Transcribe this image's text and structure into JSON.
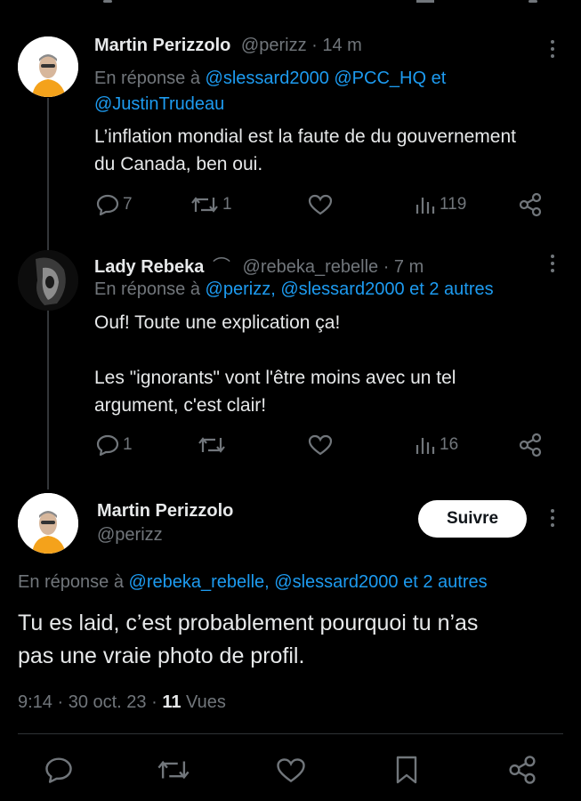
{
  "replies": [
    {
      "author": "Martin Perizzolo",
      "handle": "@perizz",
      "time": "· 14 m",
      "reply_to_prefix": "En réponse à",
      "reply_to_line1": "@slessard2000 @PCC_HQ et",
      "reply_to_line2": "@JustinTrudeau",
      "text_line1": "L’inflation mondial est la faute de du gouvernement",
      "text_line2": "du Canada, ben oui.",
      "stats": {
        "replies": "7",
        "reposts": "1",
        "views": "119"
      }
    },
    {
      "author": "Lady Rebeka",
      "author_emoji": "⌒",
      "handle": "@rebeka_rebelle",
      "time": "· 7 m",
      "reply_to_prefix": "En réponse à",
      "reply_to": "@perizz, @slessard2000 et 2 autres",
      "text_line1": "Ouf! Toute une explication ça!",
      "text_line3": "Les \"ignorants\" vont l'être moins avec un tel",
      "text_line4": "argument, c'est clair!",
      "stats": {
        "replies": "1",
        "views": "16"
      }
    }
  ],
  "main_tweet": {
    "author": "Martin Perizzolo",
    "handle": "@perizz",
    "follow_label": "Suivre",
    "reply_to_prefix": "En réponse à",
    "reply_to": "@rebeka_rebelle, @slessard2000 et 2 autres",
    "text_line1": "Tu es laid, c’est probablement pourquoi tu n’as",
    "text_line2": "pas une vraie photo de profil.",
    "timestamp": "9:14 · 30 oct. 23 ·",
    "views_count": "11",
    "views_label": "Vues"
  },
  "icons": [
    "reply-icon",
    "repost-icon",
    "like-icon",
    "views-icon",
    "share-icon",
    "bookmark-icon",
    "more-icon"
  ],
  "colors": {
    "background": "#000000",
    "text": "#e7e9ea",
    "secondary": "#71767b",
    "link": "#1d9bf0",
    "avatar_shirt": "#f4a21b"
  }
}
